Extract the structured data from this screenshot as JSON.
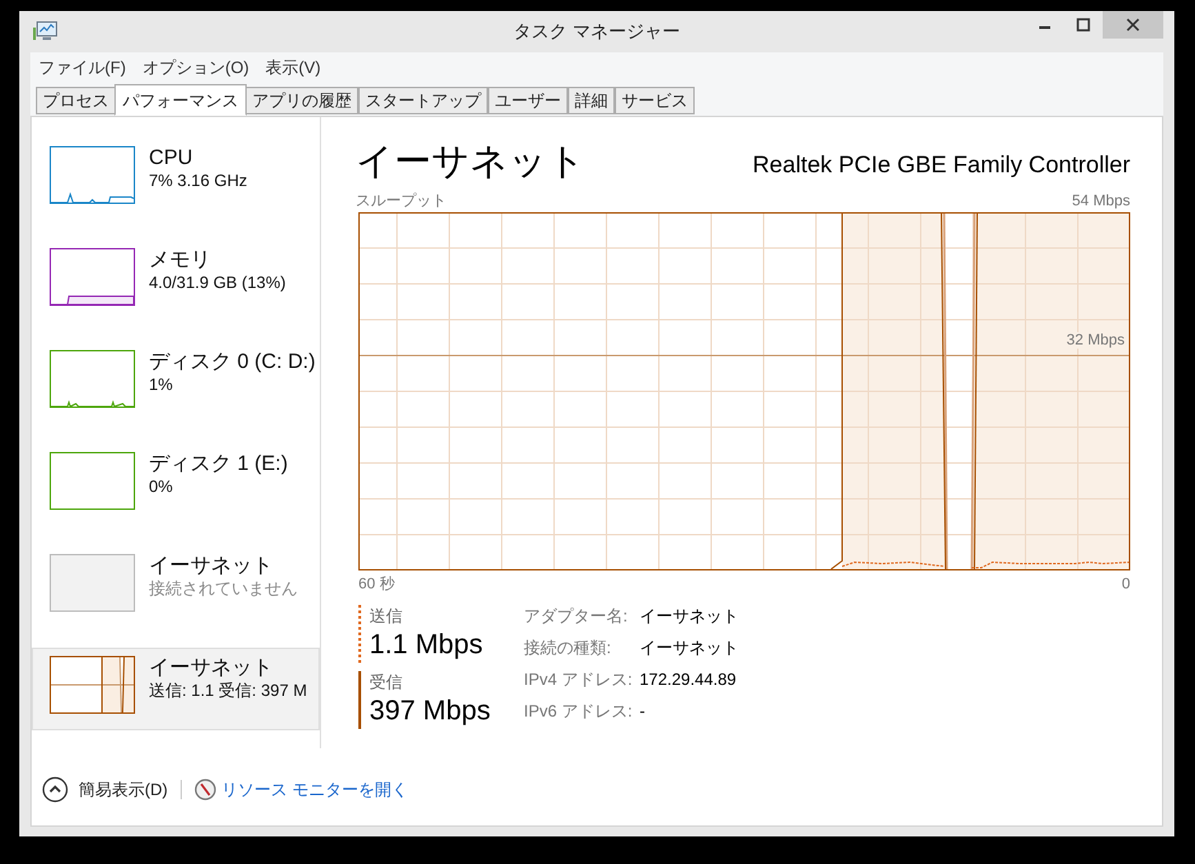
{
  "window": {
    "title": "タスク マネージャー"
  },
  "menu": [
    "ファイル(F)",
    "オプション(O)",
    "表示(V)"
  ],
  "tabs": [
    {
      "label": "プロセス",
      "selected": false
    },
    {
      "label": "パフォーマンス",
      "selected": true
    },
    {
      "label": "アプリの履歴",
      "selected": false
    },
    {
      "label": "スタートアップ",
      "selected": false
    },
    {
      "label": "ユーザー",
      "selected": false
    },
    {
      "label": "詳細",
      "selected": false
    },
    {
      "label": "サービス",
      "selected": false
    }
  ],
  "sidebar": {
    "items": [
      {
        "kind": "cpu",
        "title": "CPU",
        "subtitle": "7% 3.16 GHz",
        "color": "#1a86c8",
        "disabled": false,
        "selected": false
      },
      {
        "kind": "memory",
        "title": "メモリ",
        "subtitle": "4.0/31.9 GB (13%)",
        "color": "#9528b4",
        "disabled": false,
        "selected": false
      },
      {
        "kind": "disk",
        "title": "ディスク 0 (C: D:)",
        "subtitle": "1%",
        "color": "#4da60c",
        "disabled": false,
        "selected": false
      },
      {
        "kind": "idle",
        "title": "ディスク 1 (E:)",
        "subtitle": "0%",
        "color": "#4da60c",
        "disabled": false,
        "selected": false
      },
      {
        "kind": "idle",
        "title": "イーサネット",
        "subtitle": "接続されていません",
        "color": "#bcbcbc",
        "disabled": true,
        "selected": false
      },
      {
        "kind": "network",
        "title": "イーサネット",
        "subtitle": "送信: 1.1 受信: 397 M",
        "color": "#a74f01",
        "disabled": false,
        "selected": true
      }
    ]
  },
  "detail": {
    "title": "イーサネット",
    "adapter": "Realtek PCIe GBE Family Controller",
    "graph": {
      "label": "スループット",
      "max": "54 Mbps",
      "mid": "32 Mbps",
      "start": "60 秒",
      "end": "0"
    },
    "send": {
      "label": "送信",
      "value": "1.1 Mbps"
    },
    "receive": {
      "label": "受信",
      "value": "397 Mbps"
    },
    "properties": [
      {
        "name": "アダプター名:",
        "value": "イーサネット"
      },
      {
        "name": "接続の種類:",
        "value": "イーサネット"
      },
      {
        "name": "IPv4 アドレス:",
        "value": "172.29.44.89"
      },
      {
        "name": "IPv6 アドレス:",
        "value": "-"
      }
    ]
  },
  "footer": {
    "fewer_details": "簡易表示(D)",
    "resource_monitor": "リソース モニターを開く"
  }
}
